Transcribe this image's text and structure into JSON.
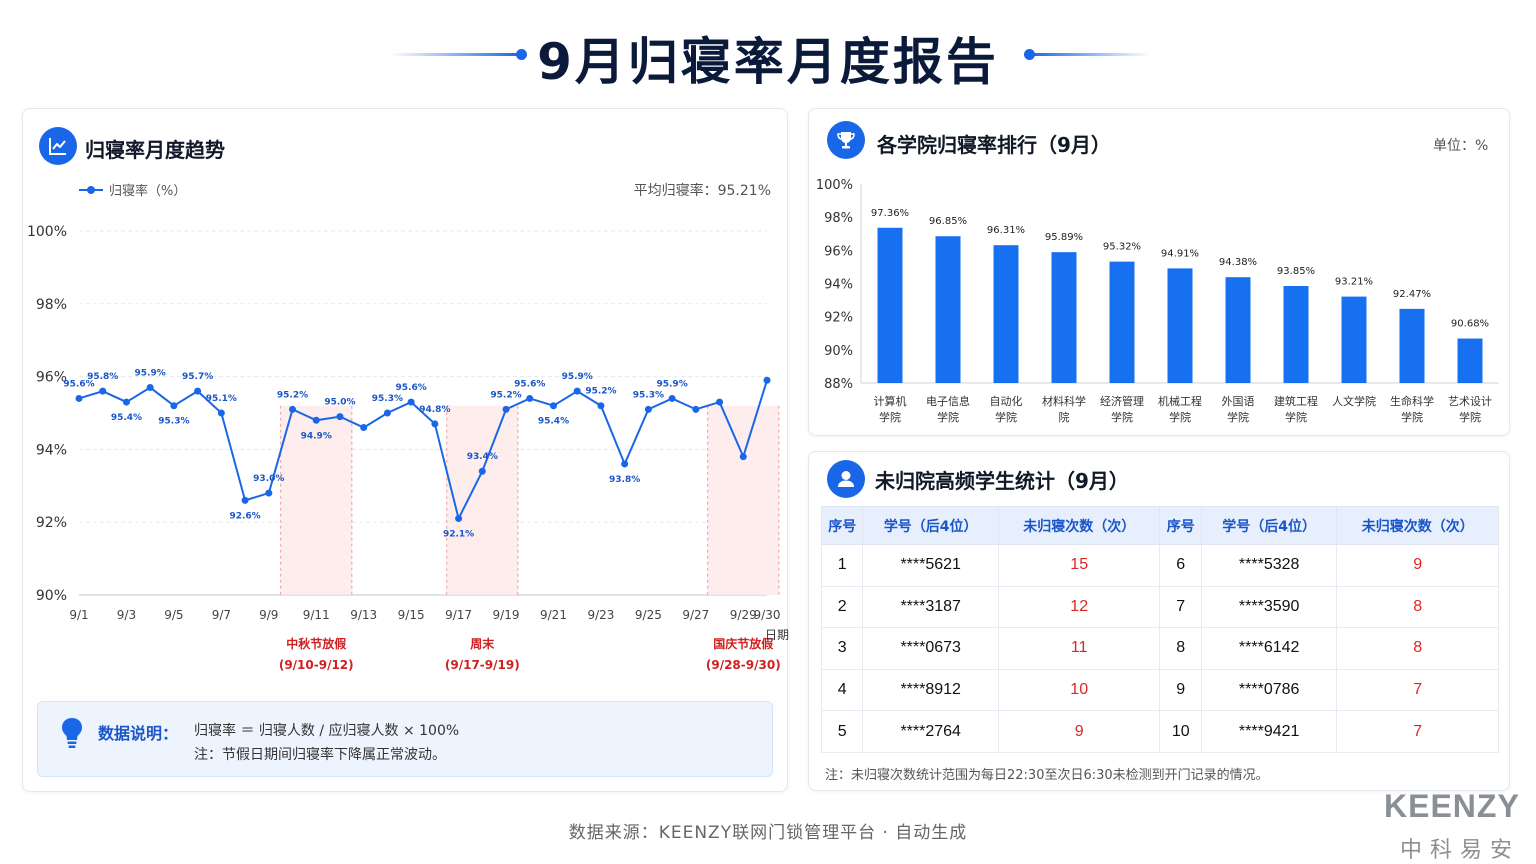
{
  "header": {
    "title": "9月归寝率月度报告"
  },
  "trend": {
    "title": "归寝率月度趋势",
    "legend_label": "归寝率（%）",
    "average_label": "平均归寝率：95.21%",
    "x_axis_name": "日期",
    "holidays": [
      {
        "name": "中秋节放假",
        "range": "(9/10-9/12)",
        "start_day": 10,
        "end_day": 12
      },
      {
        "name": "周末",
        "range": "(9/17-9/19)",
        "start_day": 17,
        "end_day": 19
      },
      {
        "name": "国庆节放假",
        "range": "(9/28-9/30)",
        "start_day": 28,
        "end_day": 30
      }
    ],
    "note_label": "数据说明：",
    "note_formula": "归寝率 ＝ 归寝人数 / 应归寝人数 × 100%",
    "note_remark": "注：节假日期间归寝率下降属正常波动。"
  },
  "ranking": {
    "title": "各学院归寝率排行（9月）",
    "unit": "单位：%"
  },
  "absence": {
    "title": "未归院高频学生统计（9月）",
    "headers": [
      "序号",
      "学号（后4位）",
      "未归寝次数（次）",
      "序号",
      "学号（后4位）",
      "未归寝次数（次）"
    ],
    "rows": [
      [
        "1",
        "****5621",
        "15",
        "6",
        "****5328",
        "9"
      ],
      [
        "2",
        "****3187",
        "12",
        "7",
        "****3590",
        "8"
      ],
      [
        "3",
        "****0673",
        "11",
        "8",
        "****6142",
        "8"
      ],
      [
        "4",
        "****8912",
        "10",
        "9",
        "****0786",
        "7"
      ],
      [
        "5",
        "****2764",
        "9",
        "10",
        "****9421",
        "7"
      ]
    ],
    "footnote": "注：未归寝次数统计范围为每日22:30至次日6:30未检测到开门记录的情况。"
  },
  "footer": {
    "source": "数据来源：KEENZY联网门锁管理平台 · 自动生成",
    "brand": "KEENZY",
    "brand_sub": "中科易安"
  },
  "colors": {
    "accent": "#1a66e8",
    "bar": "#1670f0",
    "holiday_text": "#d02020",
    "holiday_fill": "#fde8e8",
    "count_red": "#e02424"
  },
  "chart_data": [
    {
      "type": "line",
      "title": "归寝率月度趋势",
      "xlabel": "日期",
      "ylabel": "",
      "ylim": [
        90,
        100
      ],
      "yticks": [
        "90%",
        "92%",
        "94%",
        "96%",
        "98%",
        "100%"
      ],
      "x_tick_labels": [
        "9/1",
        "9/3",
        "9/5",
        "9/7",
        "9/9",
        "9/11",
        "9/13",
        "9/15",
        "9/17",
        "9/19",
        "9/21",
        "9/23",
        "9/25",
        "9/27",
        "9/29",
        "9/30"
      ],
      "grid": true,
      "legend": "top-left",
      "series": [
        {
          "name": "归寝率（%）",
          "x": [
            "9/1",
            "9/2",
            "9/3",
            "9/4",
            "9/5",
            "9/6",
            "9/7",
            "9/8",
            "9/9",
            "9/10",
            "9/11",
            "9/12",
            "9/13",
            "9/14",
            "9/15",
            "9/16",
            "9/17",
            "9/18",
            "9/19",
            "9/20",
            "9/21",
            "9/22",
            "9/23",
            "9/24",
            "9/25",
            "9/26",
            "9/27",
            "9/28",
            "9/29",
            "9/30"
          ],
          "values": [
            95.4,
            95.6,
            95.3,
            95.7,
            95.2,
            95.6,
            95.0,
            92.6,
            92.8,
            95.1,
            94.8,
            94.9,
            94.6,
            95.0,
            95.3,
            94.7,
            92.1,
            93.4,
            95.1,
            95.4,
            95.2,
            95.6,
            95.2,
            93.6,
            95.1,
            95.4,
            95.1,
            95.3,
            93.8,
            95.9
          ],
          "labels": [
            "95.6%",
            "95.8%",
            "95.4%",
            "95.9%",
            "95.3%",
            "95.7%",
            "95.1%",
            "92.6%",
            "93.0%",
            "95.2%",
            "94.9%",
            "95.0%",
            "",
            "95.3%",
            "95.6%",
            "94.8%",
            "92.1%",
            "93.4%",
            "95.2%",
            "95.6%",
            "95.4%",
            "95.9%",
            "95.2%",
            "93.8%",
            "95.3%",
            "95.9%",
            "",
            "",
            "",
            ""
          ]
        }
      ]
    },
    {
      "type": "bar",
      "title": "各学院归寝率排行（9月）",
      "categories": [
        [
          "计算机",
          "学院"
        ],
        [
          "电子信息",
          "学院"
        ],
        [
          "自动化",
          "学院"
        ],
        [
          "材料科学",
          "院"
        ],
        [
          "经济管理",
          "学院"
        ],
        [
          "机械工程",
          "学院"
        ],
        [
          "外国语",
          "学院"
        ],
        [
          "建筑工程",
          "学院"
        ],
        [
          "人文学院",
          ""
        ],
        [
          "生命科学",
          "学院"
        ],
        [
          "艺术设计",
          "学院"
        ]
      ],
      "values": [
        97.36,
        96.85,
        96.31,
        95.89,
        95.32,
        94.91,
        94.38,
        93.85,
        93.21,
        92.47,
        90.68
      ],
      "value_labels": [
        "97.36%",
        "96.85%",
        "96.31%",
        "95.89%",
        "95.32%",
        "94.91%",
        "94.38%",
        "93.85%",
        "93.21%",
        "92.47%",
        "90.68%"
      ],
      "ylim": [
        88,
        100
      ],
      "yticks": [
        "88%",
        "90%",
        "92%",
        "94%",
        "96%",
        "98%",
        "100%"
      ],
      "xlabel": "",
      "ylabel": ""
    }
  ]
}
